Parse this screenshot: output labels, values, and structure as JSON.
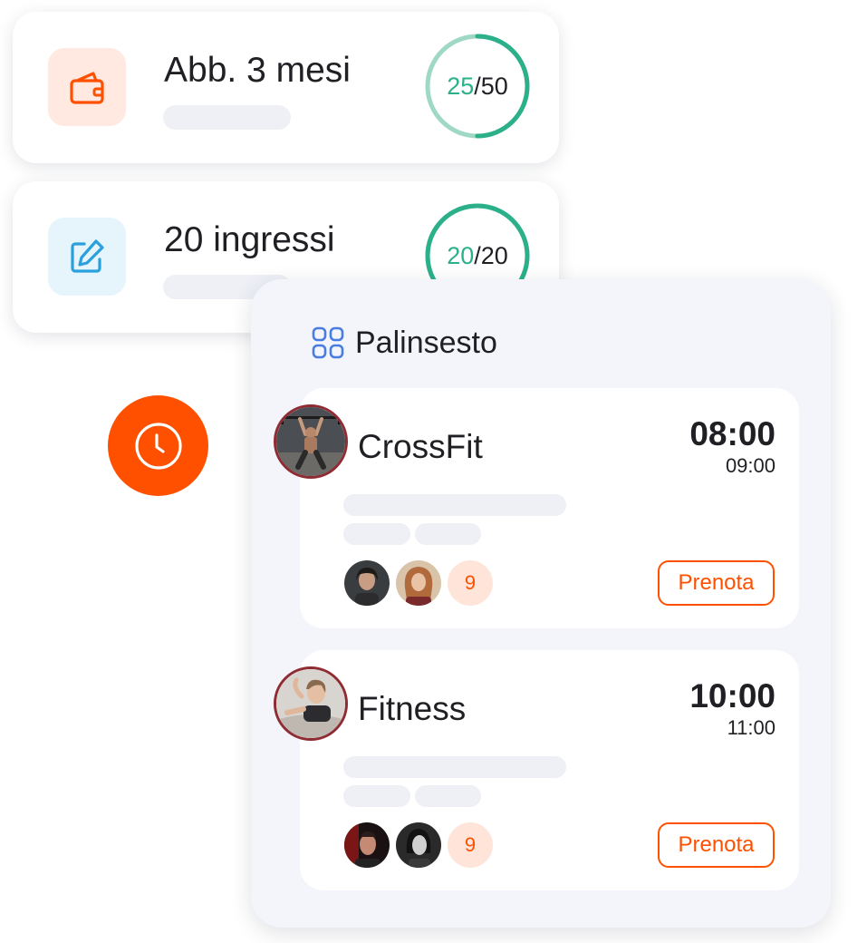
{
  "colors": {
    "accent": "#ff5000",
    "used": "#2bb08a",
    "ring_track": "#9fd8c4",
    "schedule_icon": "#4a7de2",
    "subscription_icon_bg": "#ffe9e0",
    "entries_icon_bg": "#e6f4fc",
    "entries_icon": "#2aa0dc",
    "badge_bg": "#ffe4d9"
  },
  "subscriptions": [
    {
      "title": "Abb. 3 mesi",
      "icon": "wallet-icon",
      "used": "25",
      "total": "50",
      "used_fraction": 0.5
    },
    {
      "title": "20 ingressi",
      "icon": "edit-icon",
      "used": "20",
      "total": "20",
      "used_fraction": 1.0
    }
  ],
  "ring_separator": "/",
  "clock_button_icon": "clock-icon",
  "schedule": {
    "title": "Palinsesto",
    "icon": "grid-icon",
    "classes": [
      {
        "name": "CrossFit",
        "start": "08:00",
        "end": "09:00",
        "participants_extra": "9",
        "book_label": "Prenota",
        "photo": "weightlifter-photo"
      },
      {
        "name": "Fitness",
        "start": "10:00",
        "end": "11:00",
        "participants_extra": "9",
        "book_label": "Prenota",
        "photo": "situp-woman-photo"
      }
    ]
  }
}
